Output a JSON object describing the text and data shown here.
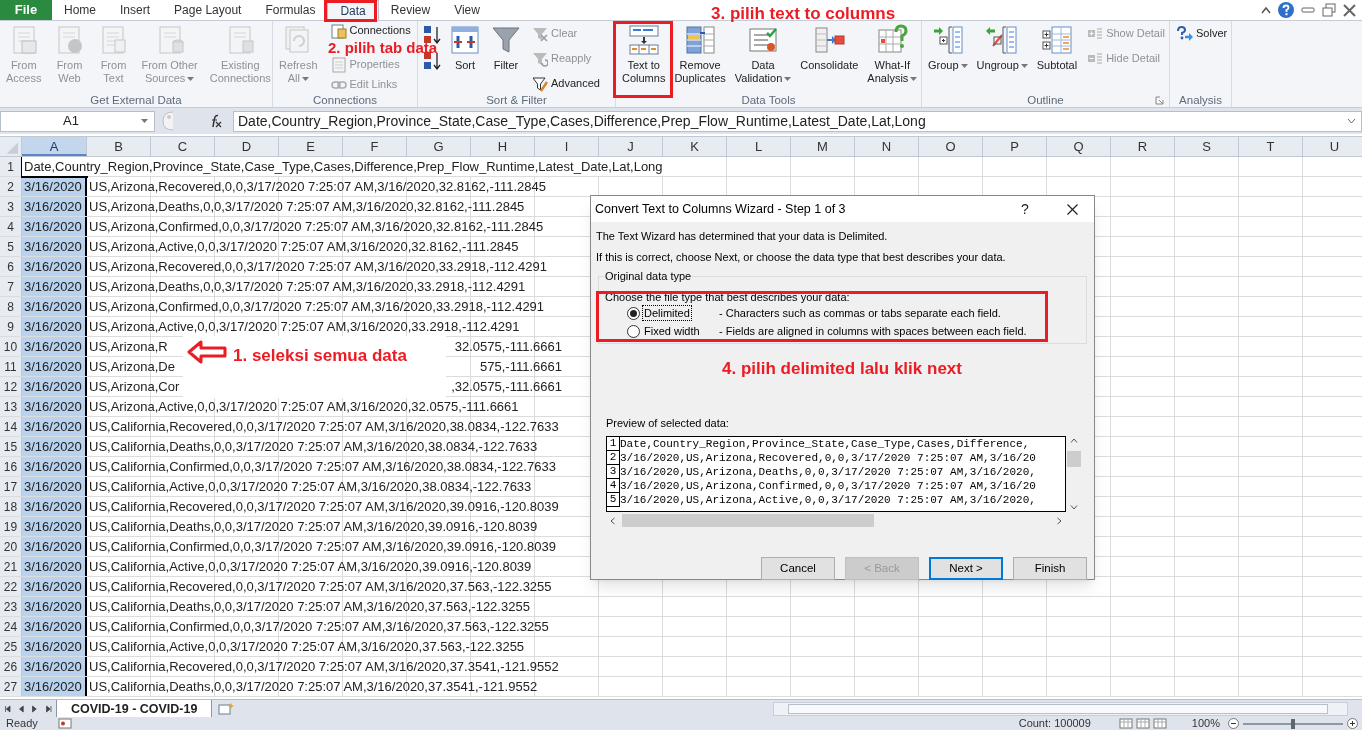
{
  "ribbon_tabs": [
    {
      "label": "File",
      "kind": "backstage",
      "selected": false
    },
    {
      "label": "Home",
      "kind": "tab",
      "selected": false
    },
    {
      "label": "Insert",
      "kind": "tab",
      "selected": false
    },
    {
      "label": "Page Layout",
      "kind": "tab",
      "selected": false
    },
    {
      "label": "Formulas",
      "kind": "tab",
      "selected": false
    },
    {
      "label": "Data",
      "kind": "tab",
      "selected": true
    },
    {
      "label": "Review",
      "kind": "tab",
      "selected": false
    },
    {
      "label": "View",
      "kind": "tab",
      "selected": false
    }
  ],
  "ribbon_groups": [
    {
      "label": "Get External Data",
      "launcher": false,
      "commands": [
        {
          "kind": "large",
          "label": "From\nAccess",
          "disabled": true,
          "menu": false
        },
        {
          "kind": "large",
          "label": "From\nWeb",
          "disabled": true,
          "menu": false
        },
        {
          "kind": "large",
          "label": "From\nText",
          "disabled": true,
          "menu": false
        },
        {
          "kind": "large",
          "label": "From Other\nSources",
          "disabled": true,
          "menu": true
        },
        {
          "kind": "large",
          "label": "Existing\nConnections",
          "disabled": true,
          "menu": false
        }
      ]
    },
    {
      "label": "Connections",
      "launcher": false,
      "commands": [
        {
          "kind": "large",
          "label": "Refresh\nAll",
          "disabled": true,
          "menu": true
        },
        {
          "kind": "small",
          "label": "Connections",
          "disabled": false,
          "menu": false
        },
        {
          "kind": "small",
          "label": "Properties",
          "disabled": true,
          "menu": false
        },
        {
          "kind": "small",
          "label": "Edit Links",
          "disabled": true,
          "menu": false
        }
      ]
    },
    {
      "label": "Sort & Filter",
      "launcher": false,
      "commands": [
        {
          "kind": "sorticons"
        },
        {
          "kind": "large",
          "label": "Sort",
          "disabled": false,
          "menu": false
        },
        {
          "kind": "large",
          "label": "Filter",
          "disabled": false,
          "menu": false
        },
        {
          "kind": "small",
          "label": "Clear",
          "disabled": true,
          "menu": false
        },
        {
          "kind": "small",
          "label": "Reapply",
          "disabled": true,
          "menu": false
        },
        {
          "kind": "small",
          "label": "Advanced",
          "disabled": false,
          "menu": false
        }
      ]
    },
    {
      "label": "Data Tools",
      "launcher": false,
      "commands": [
        {
          "kind": "large",
          "label": "Text to\nColumns",
          "disabled": false,
          "menu": false
        },
        {
          "kind": "large",
          "label": "Remove\nDuplicates",
          "disabled": false,
          "menu": false
        },
        {
          "kind": "large",
          "label": "Data\nValidation",
          "disabled": false,
          "menu": true
        },
        {
          "kind": "large",
          "label": "Consolidate",
          "disabled": false,
          "menu": false
        },
        {
          "kind": "large",
          "label": "What-If\nAnalysis",
          "disabled": false,
          "menu": true
        }
      ]
    },
    {
      "label": "Outline",
      "launcher": true,
      "commands": [
        {
          "kind": "large",
          "label": "Group",
          "disabled": false,
          "menu": true
        },
        {
          "kind": "large",
          "label": "Ungroup",
          "disabled": false,
          "menu": true
        },
        {
          "kind": "large",
          "label": "Subtotal",
          "disabled": false,
          "menu": false
        },
        {
          "kind": "small",
          "label": "Show Detail",
          "disabled": true,
          "menu": false
        },
        {
          "kind": "small",
          "label": "Hide Detail",
          "disabled": true,
          "menu": false
        }
      ]
    },
    {
      "label": "Analysis",
      "launcher": false,
      "commands": [
        {
          "kind": "small",
          "label": "Solver",
          "disabled": false,
          "menu": false
        }
      ]
    }
  ],
  "formula_bar": {
    "name_box": "A1",
    "formula": "Date,Country_Region,Province_State,Case_Type,Cases,Difference,Prep_Flow_Runtime,Latest_Date,Lat,Long"
  },
  "columns": [
    {
      "label": "A",
      "selected": true
    },
    {
      "label": "B",
      "selected": false
    },
    {
      "label": "C",
      "selected": false
    },
    {
      "label": "D",
      "selected": false
    },
    {
      "label": "E",
      "selected": false
    },
    {
      "label": "F",
      "selected": false
    },
    {
      "label": "G",
      "selected": false
    },
    {
      "label": "H",
      "selected": false
    },
    {
      "label": "I",
      "selected": false
    },
    {
      "label": "J",
      "selected": false
    },
    {
      "label": "K",
      "selected": false
    },
    {
      "label": "L",
      "selected": false
    },
    {
      "label": "M",
      "selected": false
    },
    {
      "label": "N",
      "selected": false
    },
    {
      "label": "O",
      "selected": false
    },
    {
      "label": "P",
      "selected": false
    },
    {
      "label": "Q",
      "selected": false
    },
    {
      "label": "R",
      "selected": false
    },
    {
      "label": "S",
      "selected": false
    },
    {
      "label": "T",
      "selected": false
    },
    {
      "label": "U",
      "selected": false
    }
  ],
  "rows": [
    {
      "number": "1",
      "active": true,
      "text": "Date,Country_Region,Province_State,Case_Type,Cases,Difference,Prep_Flow_Runtime,Latest_Date,Lat,Long"
    },
    {
      "number": "2",
      "active": false,
      "date": "3/16/2020",
      "text": "US,Arizona,Recovered,0,0,3/17/2020 7:25:07 AM,3/16/2020,32.8162,-111.2845"
    },
    {
      "number": "3",
      "active": false,
      "date": "3/16/2020",
      "text": "US,Arizona,Deaths,0,0,3/17/2020 7:25:07 AM,3/16/2020,32.8162,-111.2845"
    },
    {
      "number": "4",
      "active": false,
      "date": "3/16/2020",
      "text": "US,Arizona,Confirmed,0,0,3/17/2020 7:25:07 AM,3/16/2020,32.8162,-111.2845"
    },
    {
      "number": "5",
      "active": false,
      "date": "3/16/2020",
      "text": "US,Arizona,Active,0,0,3/17/2020 7:25:07 AM,3/16/2020,32.8162,-111.2845"
    },
    {
      "number": "6",
      "active": false,
      "date": "3/16/2020",
      "text": "US,Arizona,Recovered,0,0,3/17/2020 7:25:07 AM,3/16/2020,33.2918,-112.4291"
    },
    {
      "number": "7",
      "active": false,
      "date": "3/16/2020",
      "text": "US,Arizona,Deaths,0,0,3/17/2020 7:25:07 AM,3/16/2020,33.2918,-112.4291"
    },
    {
      "number": "8",
      "active": false,
      "date": "3/16/2020",
      "text": "US,Arizona,Confirmed,0,0,3/17/2020 7:25:07 AM,3/16/2020,33.2918,-112.4291"
    },
    {
      "number": "9",
      "active": false,
      "date": "3/16/2020",
      "text": "US,Arizona,Active,0,0,3/17/2020 7:25:07 AM,3/16/2020,33.2918,-112.4291"
    },
    {
      "number": "10",
      "active": false,
      "date": "3/16/2020",
      "text": "US,Arizona,R",
      "tail": "32.0575,-111.6661"
    },
    {
      "number": "11",
      "active": false,
      "date": "3/16/2020",
      "text": "US,Arizona,De",
      "tail": "575,-111.6661"
    },
    {
      "number": "12",
      "active": false,
      "date": "3/16/2020",
      "text": "US,Arizona,Cor",
      "tail": ",32.0575,-111.6661"
    },
    {
      "number": "13",
      "active": false,
      "date": "3/16/2020",
      "text": "US,Arizona,Active,0,0,3/17/2020 7:25:07 AM,3/16/2020,32.0575,-111.6661"
    },
    {
      "number": "14",
      "active": false,
      "date": "3/16/2020",
      "text": "US,California,Recovered,0,0,3/17/2020 7:25:07 AM,3/16/2020,38.0834,-122.7633"
    },
    {
      "number": "15",
      "active": false,
      "date": "3/16/2020",
      "text": "US,California,Deaths,0,0,3/17/2020 7:25:07 AM,3/16/2020,38.0834,-122.7633"
    },
    {
      "number": "16",
      "active": false,
      "date": "3/16/2020",
      "text": "US,California,Confirmed,0,0,3/17/2020 7:25:07 AM,3/16/2020,38.0834,-122.7633"
    },
    {
      "number": "17",
      "active": false,
      "date": "3/16/2020",
      "text": "US,California,Active,0,0,3/17/2020 7:25:07 AM,3/16/2020,38.0834,-122.7633"
    },
    {
      "number": "18",
      "active": false,
      "date": "3/16/2020",
      "text": "US,California,Recovered,0,0,3/17/2020 7:25:07 AM,3/16/2020,39.0916,-120.8039"
    },
    {
      "number": "19",
      "active": false,
      "date": "3/16/2020",
      "text": "US,California,Deaths,0,0,3/17/2020 7:25:07 AM,3/16/2020,39.0916,-120.8039"
    },
    {
      "number": "20",
      "active": false,
      "date": "3/16/2020",
      "text": "US,California,Confirmed,0,0,3/17/2020 7:25:07 AM,3/16/2020,39.0916,-120.8039"
    },
    {
      "number": "21",
      "active": false,
      "date": "3/16/2020",
      "text": "US,California,Active,0,0,3/17/2020 7:25:07 AM,3/16/2020,39.0916,-120.8039"
    },
    {
      "number": "22",
      "active": false,
      "date": "3/16/2020",
      "text": "US,California,Recovered,0,0,3/17/2020 7:25:07 AM,3/16/2020,37.563,-122.3255"
    },
    {
      "number": "23",
      "active": false,
      "date": "3/16/2020",
      "text": "US,California,Deaths,0,0,3/17/2020 7:25:07 AM,3/16/2020,37.563,-122.3255"
    },
    {
      "number": "24",
      "active": false,
      "date": "3/16/2020",
      "text": "US,California,Confirmed,0,0,3/17/2020 7:25:07 AM,3/16/2020,37.563,-122.3255"
    },
    {
      "number": "25",
      "active": false,
      "date": "3/16/2020",
      "text": "US,California,Active,0,0,3/17/2020 7:25:07 AM,3/16/2020,37.563,-122.3255"
    },
    {
      "number": "26",
      "active": false,
      "date": "3/16/2020",
      "text": "US,California,Recovered,0,0,3/17/2020 7:25:07 AM,3/16/2020,37.3541,-121.9552"
    },
    {
      "number": "27",
      "active": false,
      "date": "3/16/2020",
      "text": "US,California,Deaths,0,0,3/17/2020 7:25:07 AM,3/16/2020,37.3541,-121.9552"
    }
  ],
  "sheet_tabs": [
    {
      "label": "COVID-19 - COVID-19",
      "selected": true
    }
  ],
  "status_bar": {
    "mode": "Ready",
    "count": "Count: 100009",
    "zoom": "100%",
    "zoom_slider": {
      "level": 0.5
    }
  },
  "dialog": {
    "title": "Convert Text to Columns Wizard - Step 1 of 3",
    "help": "?",
    "messages": [
      "The Text Wizard has determined that your data is Delimited.",
      "If this is correct, choose Next, or choose the data type that best describes your data."
    ],
    "group_label": "Original data type",
    "prompt": "Choose the file type that best describes your data:",
    "options": [
      {
        "label": "Delimited",
        "description": "- Characters such as commas or tabs separate each field.",
        "selected": true,
        "focused": true
      },
      {
        "label": "Fixed width",
        "description": "- Fields are aligned in columns with spaces between each field.",
        "selected": false,
        "focused": false
      }
    ],
    "preview_label": "Preview of selected data:",
    "preview_lines": [
      {
        "number": "1",
        "text": "Date,Country_Region,Province_State,Case_Type,Cases,Difference,"
      },
      {
        "number": "2",
        "text": "3/16/2020,US,Arizona,Recovered,0,0,3/17/2020 7:25:07 AM,3/16/20"
      },
      {
        "number": "3",
        "text": "3/16/2020,US,Arizona,Deaths,0,0,3/17/2020 7:25:07 AM,3/16/2020,"
      },
      {
        "number": "4",
        "text": "3/16/2020,US,Arizona,Confirmed,0,0,3/17/2020 7:25:07 AM,3/16/20"
      },
      {
        "number": "5",
        "text": "3/16/2020,US,Arizona,Active,0,0,3/17/2020 7:25:07 AM,3/16/2020,"
      }
    ],
    "buttons": [
      {
        "label": "Cancel",
        "disabled": false,
        "default": false
      },
      {
        "label": "< Back",
        "disabled": true,
        "default": false
      },
      {
        "label": "Next >",
        "disabled": false,
        "default": true
      },
      {
        "label": "Finish",
        "disabled": false,
        "default": false
      }
    ]
  },
  "annotations": [
    {
      "text": "2. pilih tab data"
    },
    {
      "text": "3. pilih text to columns"
    },
    {
      "text": "1. seleksi semua data"
    },
    {
      "text": "4. pilih delimited lalu klik next"
    }
  ]
}
